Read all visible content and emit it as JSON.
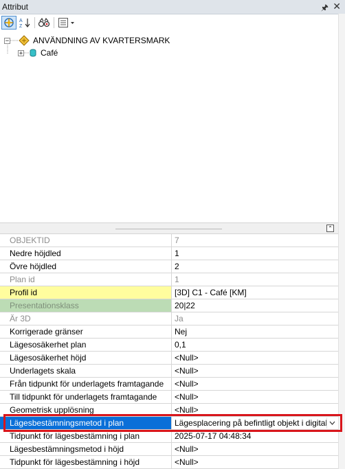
{
  "window": {
    "title": "Attribut",
    "pin_icon": "pin-icon",
    "close_icon": "close-icon"
  },
  "toolbar": {
    "buttons": [
      {
        "name": "list-by-layer-button",
        "icon": "layer-list-icon",
        "active": true
      },
      {
        "name": "sort-az-button",
        "icon": "sort-az-icon"
      },
      {
        "name": "find-button",
        "icon": "binoculars-icon"
      },
      {
        "name": "options-dropdown-button",
        "icon": "options-menu-icon"
      }
    ]
  },
  "tree": {
    "root": {
      "expander": "−",
      "label": "ANVÄNDNING AV KVARTERSMARK"
    },
    "child": {
      "expander": "+",
      "label": "Café"
    }
  },
  "attributes": [
    {
      "name": "OBJEKTID",
      "value": "7",
      "state": "disabled"
    },
    {
      "name": "Nedre höjdled",
      "value": "1",
      "state": "normal"
    },
    {
      "name": "Övre höjdled",
      "value": "2",
      "state": "normal"
    },
    {
      "name": "Plan id",
      "value": "1",
      "state": "disabled"
    },
    {
      "name": "Profil id",
      "value": "[3D] C1 - Café [KM]",
      "state": "yellow"
    },
    {
      "name": "Presentationsklass",
      "value": "20|22",
      "state": "green"
    },
    {
      "name": "Är 3D",
      "value": "Ja",
      "state": "disabled"
    },
    {
      "name": "Korrigerade gränser",
      "value": "Nej",
      "state": "normal"
    },
    {
      "name": "Lägesosäkerhet plan",
      "value": "0,1",
      "state": "normal"
    },
    {
      "name": "Lägesosäkerhet höjd",
      "value": "<Null>",
      "state": "normal"
    },
    {
      "name": "Underlagets skala",
      "value": "<Null>",
      "state": "normal"
    },
    {
      "name": "Från tidpunkt för underlagets framtagande",
      "value": "<Null>",
      "state": "normal"
    },
    {
      "name": "Till tidpunkt för underlagets framtagande",
      "value": "<Null>",
      "state": "normal"
    },
    {
      "name": "Geometrisk upplösning",
      "value": "<Null>",
      "state": "normal"
    },
    {
      "name": "Lägesbestämningsmetod i plan",
      "value": "Lägesplacering på befintligt objekt i digital",
      "state": "selected"
    },
    {
      "name": "Tidpunkt för lägesbestämning i plan",
      "value": "2025-07-17 04:48:34",
      "state": "normal"
    },
    {
      "name": "Lägesbestämningsmetod i höjd",
      "value": "<Null>",
      "state": "normal"
    },
    {
      "name": "Tidpunkt för lägesbestämning i höjd",
      "value": "<Null>",
      "state": "normal"
    }
  ],
  "colors": {
    "selection": "#0a6fd8",
    "profile_highlight": "#fffd9e",
    "presentation_highlight": "#bcdcb5",
    "annotation_box": "#d9151b"
  }
}
